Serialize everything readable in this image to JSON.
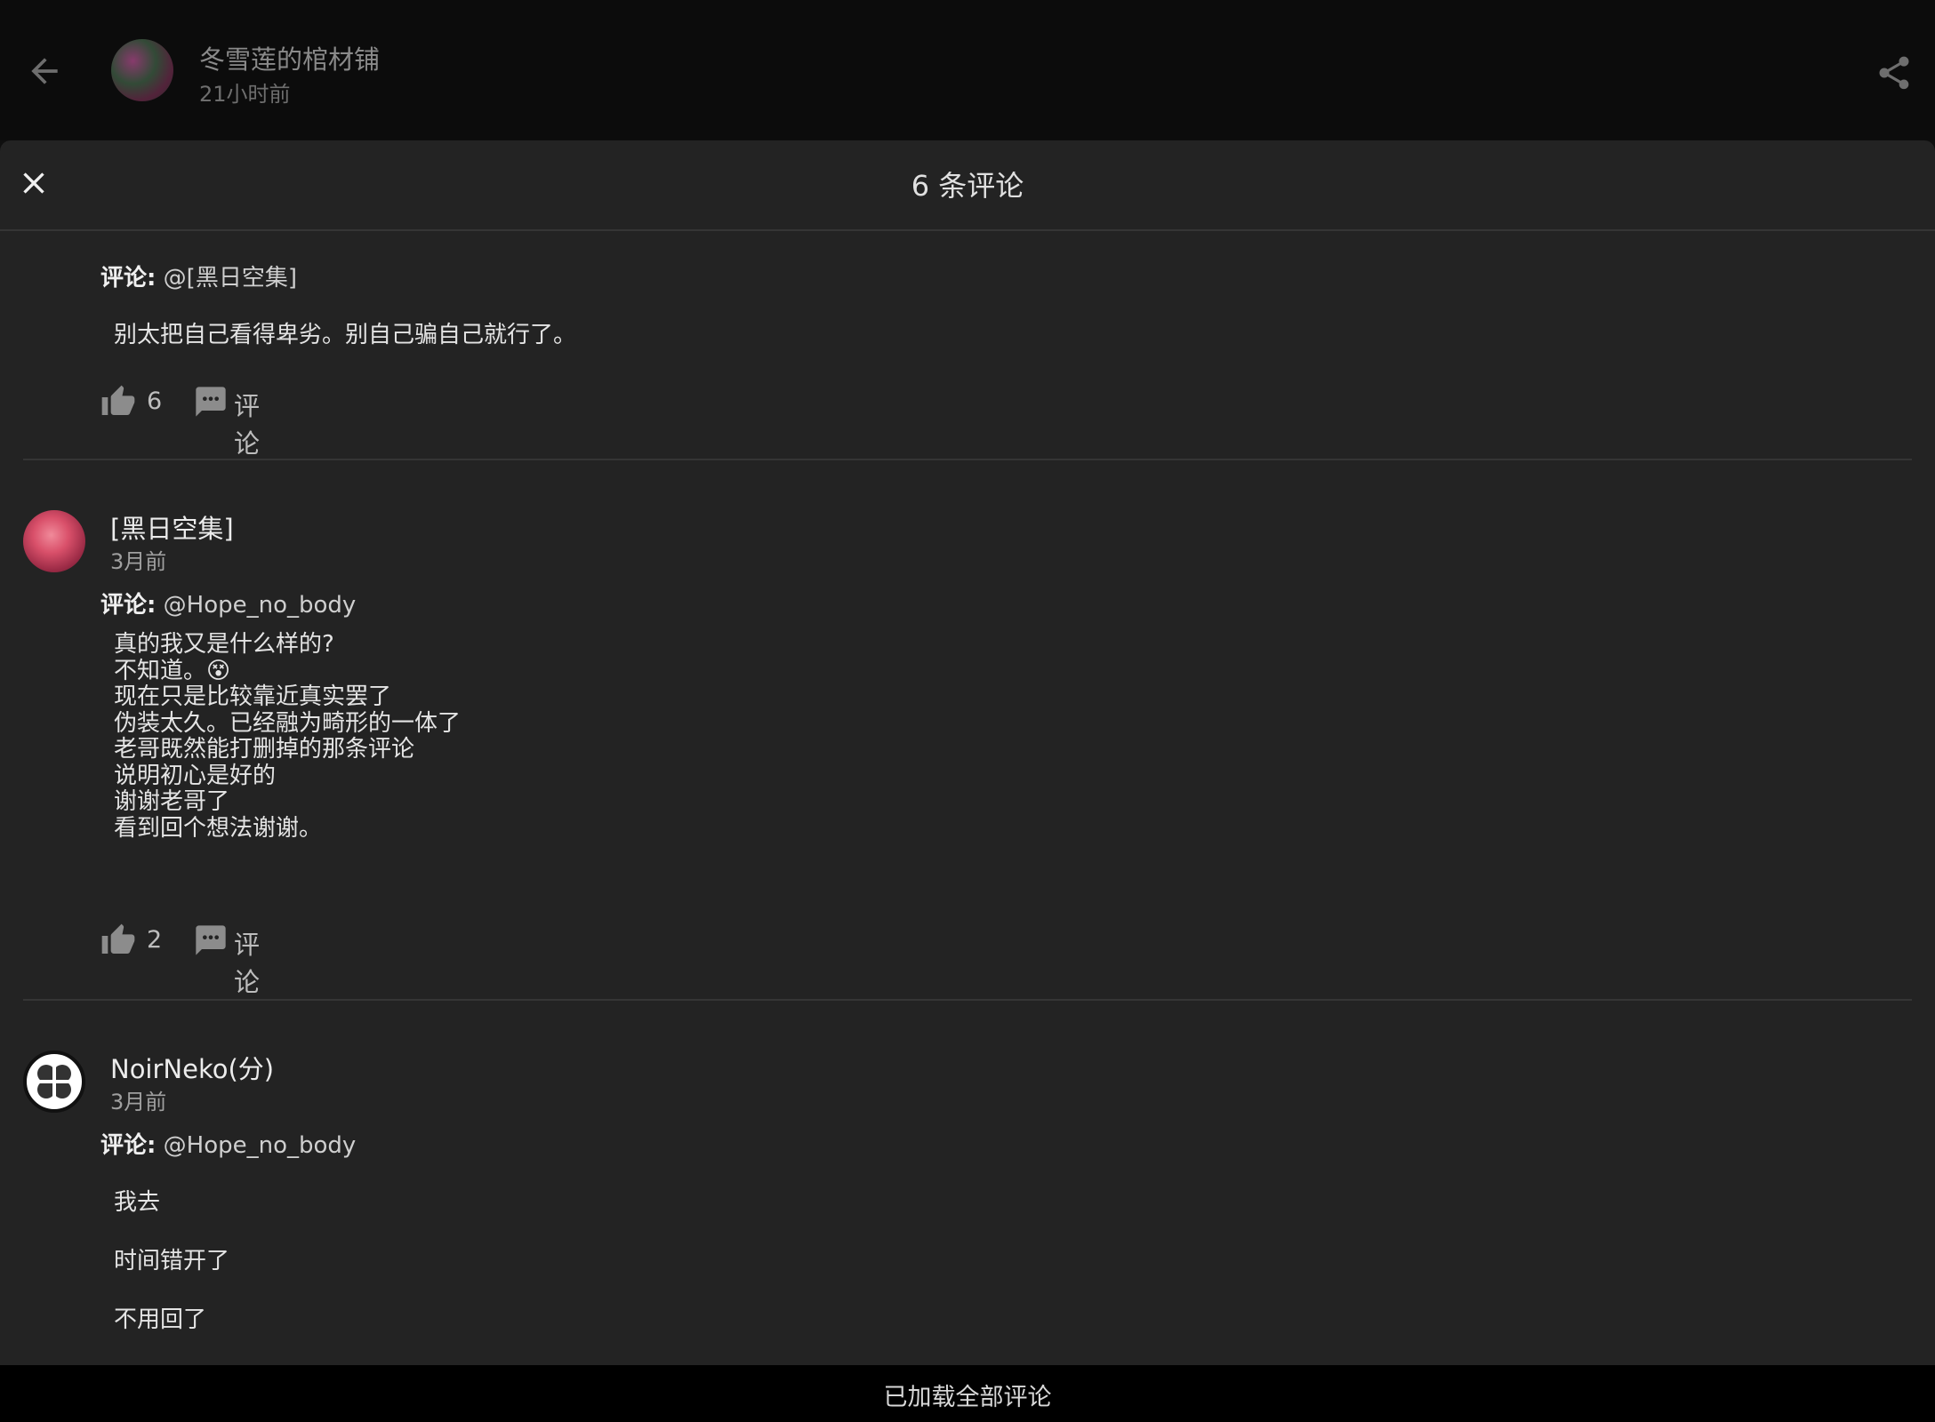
{
  "page": {
    "author_name": "冬雪莲的棺材铺",
    "author_time": "21小时前"
  },
  "sheet": {
    "title": "6 条评论"
  },
  "labels": {
    "reply_prefix": "评论:",
    "comment_action": "评论"
  },
  "comments": [
    {
      "reply_to": "@[黑日空集]",
      "lines": [
        "别太把自己看得卑劣。别自己骗自己就行了。"
      ],
      "likes": "6"
    },
    {
      "username": "[黑日空集]",
      "time": "3月前",
      "reply_to": "@Hope_no_body",
      "lines": [
        "真的我又是什么样的?",
        "不知道。😵",
        "现在只是比较靠近真实罢了",
        "伪装太久。已经融为畸形的一体了",
        "老哥既然能打删掉的那条评论",
        "说明初心是好的",
        "谢谢老哥了",
        "看到回个想法谢谢。"
      ],
      "likes": "2"
    },
    {
      "username": "NoirNeko(分)",
      "time": "3月前",
      "reply_to": "@Hope_no_body",
      "lines": [
        "我去",
        "时间错开了",
        "不用回了"
      ]
    }
  ],
  "footer": {
    "status": "已加载全部评论"
  },
  "colors": {
    "sheet_bg": "#232323",
    "page_bg": "#0f0f0f",
    "footer_bg": "#000000",
    "icon": "#8c8c8c"
  }
}
